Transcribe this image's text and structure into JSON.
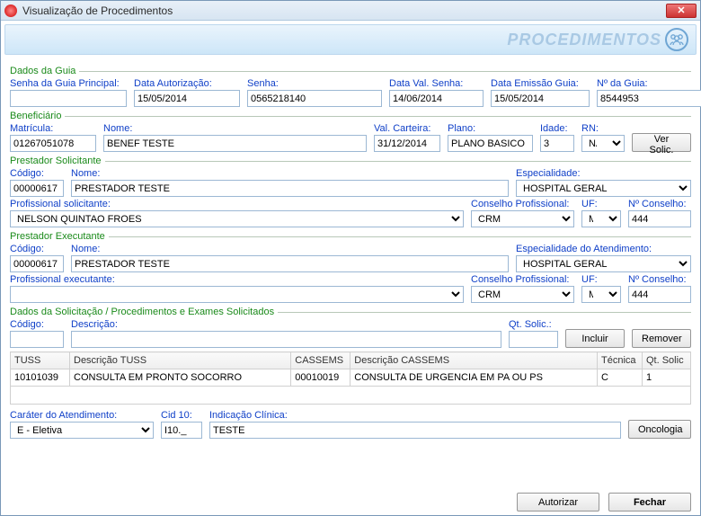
{
  "window": {
    "title": "Visualização de Procedimentos"
  },
  "banner": {
    "text": "PROCEDIMENTOS"
  },
  "groups": {
    "guia": "Dados da Guia",
    "benef": "Beneficiário",
    "prest_sol": "Prestador Solicitante",
    "prest_exe": "Prestador Executante",
    "dados_sol": "Dados da Solicitação / Procedimentos e Exames Solicitados"
  },
  "guia": {
    "senha_guia_principal": {
      "label": "Senha da Guia Principal:",
      "value": ""
    },
    "data_autorizacao": {
      "label": "Data Autorização:",
      "value": "15/05/2014"
    },
    "senha": {
      "label": "Senha:",
      "value": "0565218140"
    },
    "data_val_senha": {
      "label": "Data Val. Senha:",
      "value": "14/06/2014"
    },
    "data_emissao_guia": {
      "label": "Data Emissão Guia:",
      "value": "15/05/2014"
    },
    "no_guia": {
      "label": "Nº da Guia:",
      "value": "8544953"
    }
  },
  "benef": {
    "matricula": {
      "label": "Matrícula:",
      "value": "01267051078"
    },
    "nome": {
      "label": "Nome:",
      "value": "BENEF TESTE"
    },
    "val_carteira": {
      "label": "Val. Carteira:",
      "value": "31/12/2014"
    },
    "plano": {
      "label": "Plano:",
      "value": "PLANO BASICO"
    },
    "idade": {
      "label": "Idade:",
      "value": "3"
    },
    "rn": {
      "label": "RN:",
      "value": "NÃO"
    },
    "ver_solic": "Ver Solic."
  },
  "prest_sol": {
    "codigo": {
      "label": "Código:",
      "value": "00000617"
    },
    "nome": {
      "label": "Nome:",
      "value": "PRESTADOR TESTE"
    },
    "especialidade": {
      "label": "Especialidade:",
      "value": "HOSPITAL GERAL"
    },
    "prof_sol": {
      "label": "Profissional solicitante:",
      "value": "NELSON QUINTAO FROES"
    },
    "conselho": {
      "label": "Conselho Profissional:",
      "value": "CRM"
    },
    "uf": {
      "label": "UF:",
      "value": "MS"
    },
    "no_conselho": {
      "label": "Nº Conselho:",
      "value": "444"
    }
  },
  "prest_exe": {
    "codigo": {
      "label": "Código:",
      "value": "00000617"
    },
    "nome": {
      "label": "Nome:",
      "value": "PRESTADOR TESTE"
    },
    "especialidade": {
      "label": "Especialidade do Atendimento:",
      "value": "HOSPITAL GERAL"
    },
    "prof_exe": {
      "label": "Profissional executante:",
      "value": ""
    },
    "conselho": {
      "label": "Conselho Profissional:",
      "value": "CRM"
    },
    "uf": {
      "label": "UF:",
      "value": "MS"
    },
    "no_conselho": {
      "label": "Nº Conselho:",
      "value": "444"
    }
  },
  "proc_entry": {
    "codigo": {
      "label": "Código:",
      "value": ""
    },
    "descricao": {
      "label": "Descrição:",
      "value": ""
    },
    "qt_solic": {
      "label": "Qt. Solic.:",
      "value": ""
    },
    "incluir": "Incluir",
    "remover": "Remover"
  },
  "table": {
    "headers": {
      "tuss": "TUSS",
      "desc_tuss": "Descrição TUSS",
      "cassems": "CASSEMS",
      "desc_cassems": "Descrição CASSEMS",
      "tecnica": "Técnica",
      "qt": "Qt. Solic"
    },
    "rows": [
      {
        "tuss": "10101039",
        "desc_tuss": "CONSULTA EM PRONTO SOCORRO",
        "cassems": "00010019",
        "desc_cassems": "CONSULTA DE URGENCIA EM PA OU PS",
        "tecnica": "C",
        "qt": "1"
      }
    ]
  },
  "bottom": {
    "carater": {
      "label": "Caráter do Atendimento:",
      "value": "E - Eletiva"
    },
    "cid10": {
      "label": "Cid 10:",
      "value": "I10._"
    },
    "indicacao": {
      "label": "Indicação Clínica:",
      "value": "TESTE"
    },
    "oncologia": "Oncologia"
  },
  "footer": {
    "autorizar": "Autorizar",
    "fechar": "Fechar"
  }
}
